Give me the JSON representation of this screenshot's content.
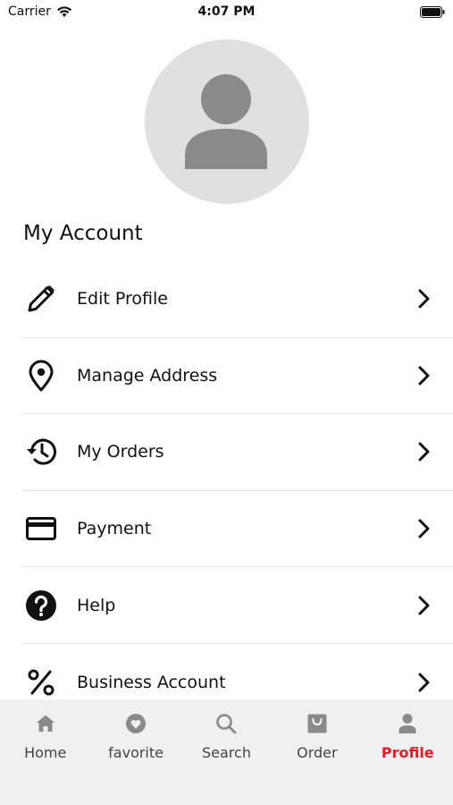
{
  "status_bar": {
    "carrier": "Carrier",
    "time": "4:07 PM"
  },
  "section_title": "My Account",
  "menu": [
    {
      "label": "Edit Profile",
      "icon": "pencil-icon"
    },
    {
      "label": "Manage Address",
      "icon": "location-pin-icon"
    },
    {
      "label": "My Orders",
      "icon": "history-icon"
    },
    {
      "label": "Payment",
      "icon": "credit-card-icon"
    },
    {
      "label": "Help",
      "icon": "help-icon"
    },
    {
      "label": "Business Account",
      "icon": "percent-icon"
    }
  ],
  "tabs": [
    {
      "label": "Home",
      "icon": "home-icon"
    },
    {
      "label": "favorite",
      "icon": "heart-icon"
    },
    {
      "label": "Search",
      "icon": "search-icon"
    },
    {
      "label": "Order",
      "icon": "shopping-bag-icon"
    },
    {
      "label": "Profile",
      "icon": "person-icon",
      "active": true
    }
  ],
  "colors": {
    "accent": "#e41b23",
    "tab_bar_bg": "#f0f0f0",
    "avatar_bg": "#e0e0e0",
    "icon_gray": "#888888"
  }
}
